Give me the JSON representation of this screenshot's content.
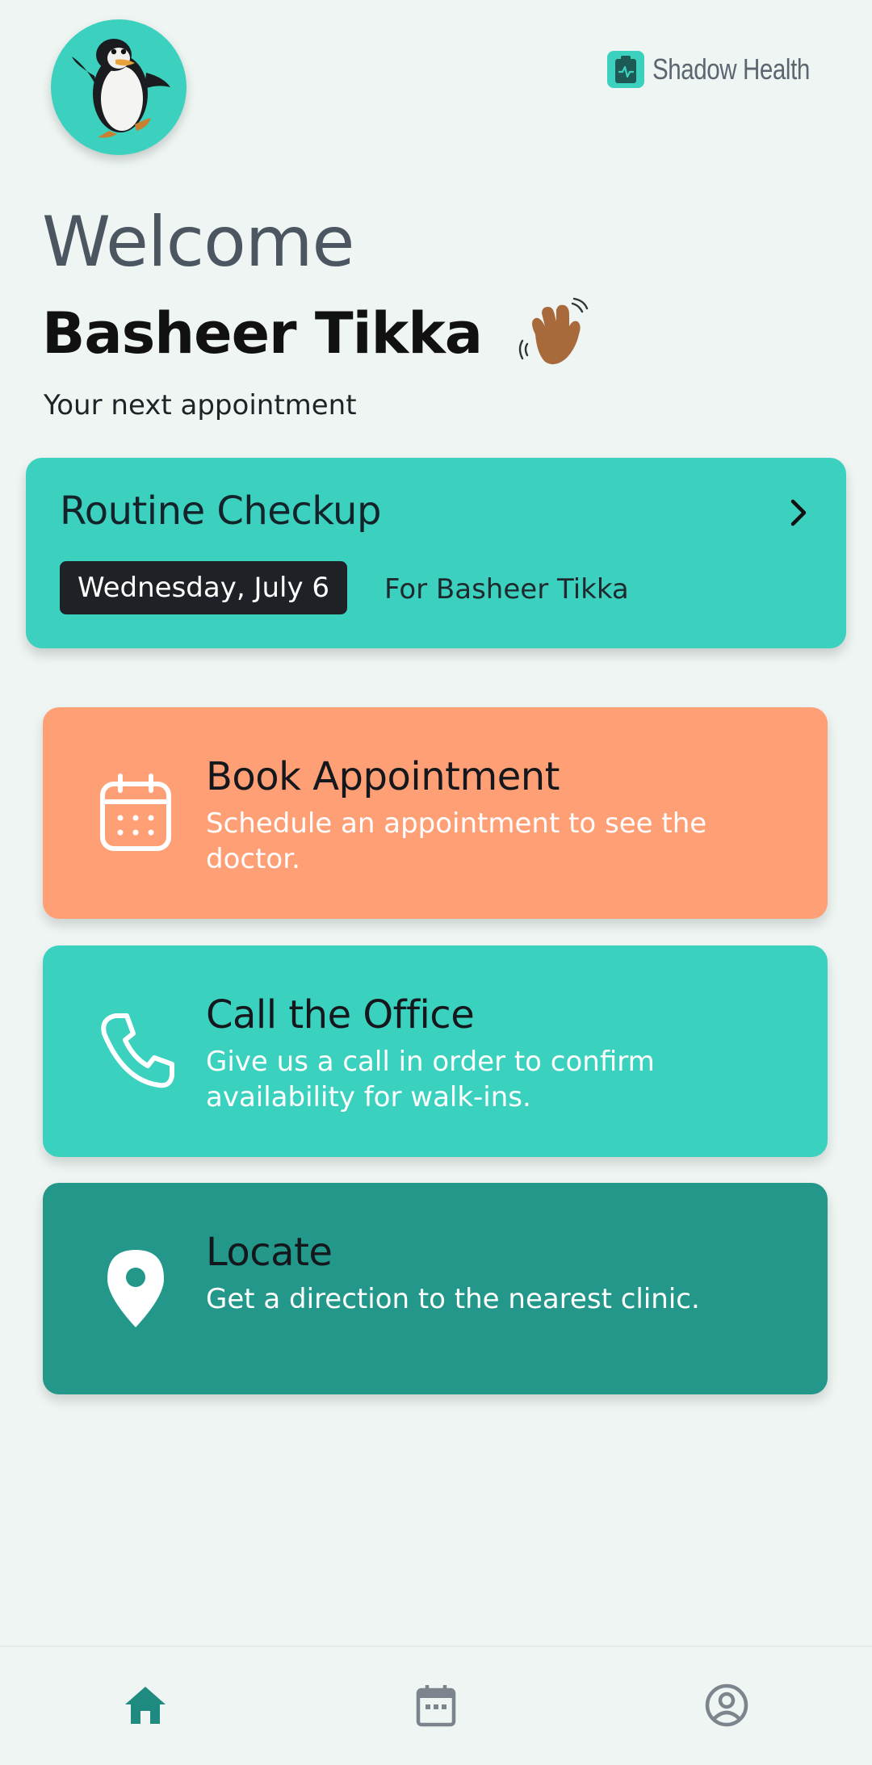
{
  "header": {
    "avatar_label": "penguin avatar",
    "brand_name": "Shadow Health"
  },
  "greeting": {
    "welcome": "Welcome",
    "user_name": "Basheer Tikka",
    "next_label": "Your next appointment"
  },
  "appointment": {
    "title": "Routine Checkup",
    "date": "Wednesday, July 6",
    "for": "For Basheer Tikka"
  },
  "actions": [
    {
      "title": "Book Appointment",
      "description": "Schedule an appointment to see the doctor.",
      "icon": "calendar-icon",
      "color": "#ff9f76"
    },
    {
      "title": "Call the Office",
      "description": "Give us a call in order to confirm availability for walk-ins.",
      "icon": "phone-icon",
      "color": "#3bd1bf"
    },
    {
      "title": "Locate",
      "description": "Get a direction to the nearest clinic.",
      "icon": "location-pin-icon",
      "color": "#22978a"
    }
  ],
  "bottom_nav": {
    "items": [
      {
        "icon": "home-icon",
        "active": true
      },
      {
        "icon": "calendar-icon",
        "active": false
      },
      {
        "icon": "profile-icon",
        "active": false
      }
    ],
    "active_color": "#1f8a7f",
    "inactive_color": "#7c858e"
  },
  "colors": {
    "background": "#eef5f2",
    "accent": "#3cd1bf",
    "book": "#ff9f76",
    "locate": "#22978a"
  }
}
